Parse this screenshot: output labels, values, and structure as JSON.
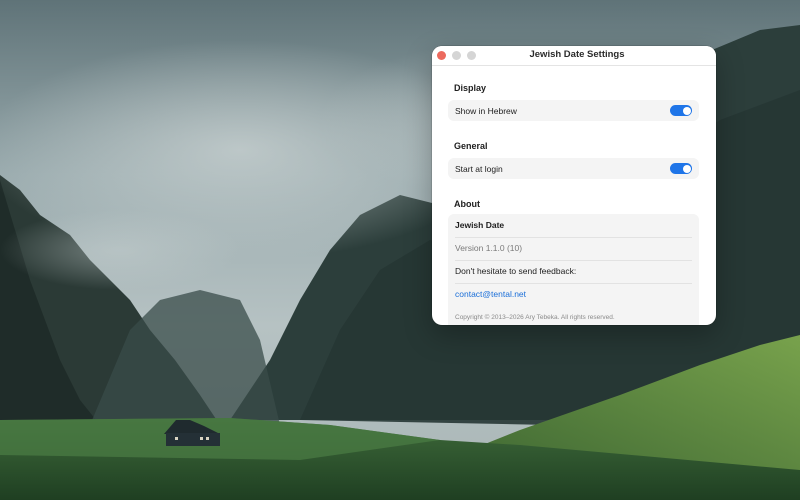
{
  "window": {
    "title": "Jewish Date Settings"
  },
  "sections": {
    "display": {
      "title": "Display",
      "show_in_hebrew_label": "Show in Hebrew",
      "show_in_hebrew_on": true
    },
    "general": {
      "title": "General",
      "start_at_login_label": "Start at login",
      "start_at_login_on": true
    },
    "about": {
      "title": "About",
      "app_name": "Jewish Date",
      "version": "Version 1.1.0 (10)",
      "feedback_text": "Don't hesitate to send feedback:",
      "contact_email": "contact@tental.net",
      "copyright": "Copyright © 2013–2026 Ary Tebeka. All rights reserved."
    }
  },
  "colors": {
    "accent": "#1f75e8",
    "link": "#1a6ed8",
    "close_button": "#ec6a5e",
    "inactive_button": "#d5d5d5"
  }
}
